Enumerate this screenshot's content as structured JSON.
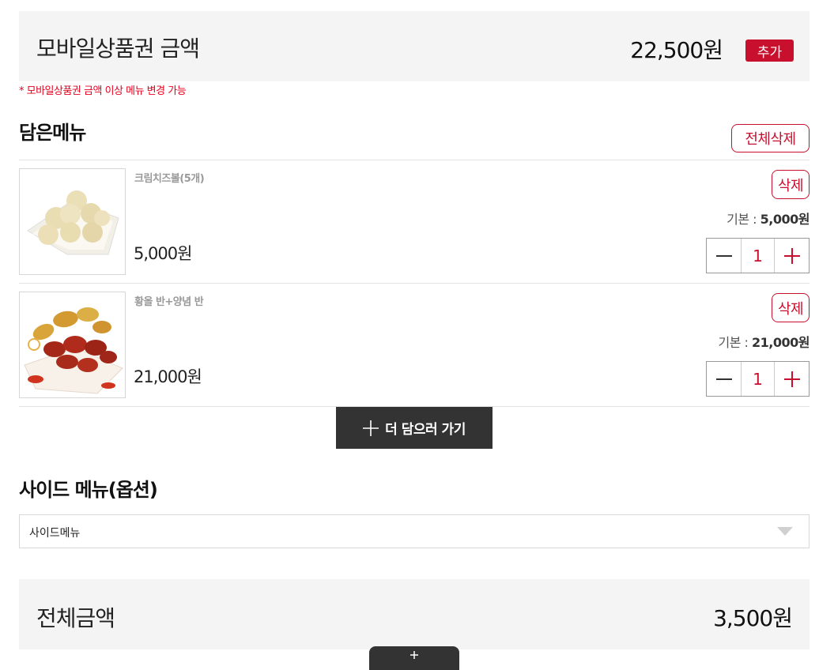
{
  "voucher": {
    "title": "모바일상품권 금액",
    "amount": "22,500원",
    "add_label": "추가",
    "notice": "* 모바일상품권 금액 이상 메뉴 변경 가능"
  },
  "cart": {
    "title": "담은메뉴",
    "delete_all_label": "전체삭제",
    "items": [
      {
        "name": "크림치즈볼(5개)",
        "price": "5,000원",
        "delete_label": "삭제",
        "base_label": "기본 : ",
        "base_price": "5,000원",
        "quantity": "1",
        "image_icon": "cream-cheese-balls-photo"
      },
      {
        "name": "황올 반+양념 반",
        "price": "21,000원",
        "delete_label": "삭제",
        "base_label": "기본 : ",
        "base_price": "21,000원",
        "quantity": "1",
        "image_icon": "half-half-chicken-photo"
      }
    ],
    "add_more_label": "더 담으러 가기"
  },
  "side_menu": {
    "title": "사이드 메뉴(옵션)",
    "selected": "사이드메뉴"
  },
  "total": {
    "label": "전체금액",
    "amount": "3,500원"
  },
  "colors": {
    "accent": "#c8102e",
    "dark_button": "#333333",
    "panel_bg": "#f4f4f4"
  }
}
